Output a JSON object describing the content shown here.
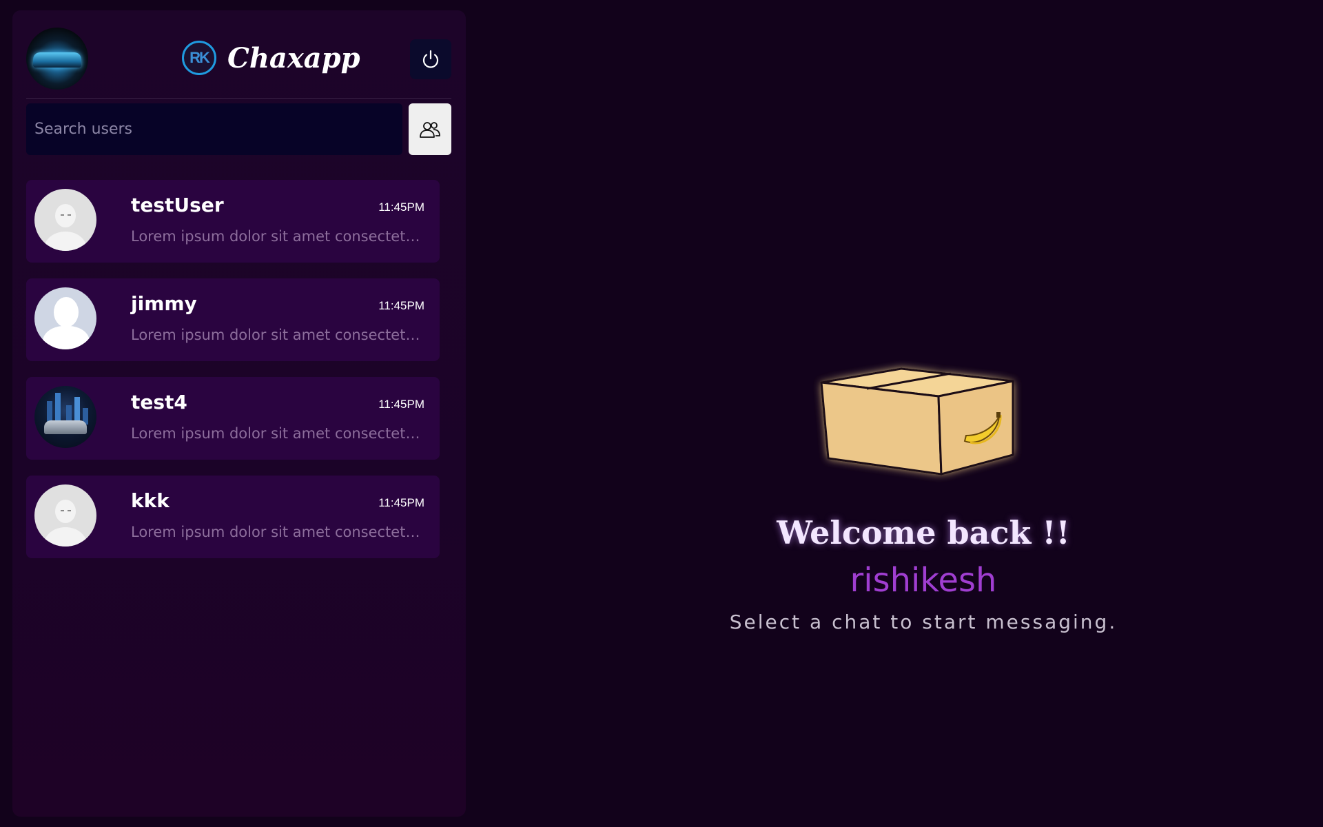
{
  "app": {
    "brand_logo_text": "RK",
    "brand_name": "Chaxapp"
  },
  "search": {
    "placeholder": "Search users",
    "value": ""
  },
  "chats": [
    {
      "name": "testUser",
      "time": "11:45PM",
      "preview": "Lorem ipsum dolor sit amet consectetur adipisicing elit.",
      "avatar": "default-avatar"
    },
    {
      "name": "jimmy",
      "time": "11:45PM",
      "preview": "Lorem ipsum dolor sit amet consectetur adipisicing elit.",
      "avatar": "silhouette-avatar"
    },
    {
      "name": "test4",
      "time": "11:45PM",
      "preview": "Lorem ipsum dolor sit amet consectetur adipisicing elit.",
      "avatar": "night-car-avatar"
    },
    {
      "name": "kkk",
      "time": "11:45PM",
      "preview": "Lorem ipsum dolor sit amet consectetur adipisicing elit.",
      "avatar": "default-avatar"
    }
  ],
  "welcome": {
    "title": "Welcome back !!",
    "username": "rishikesh",
    "subtitle": "Select a chat to start messaging."
  },
  "icons": {
    "logout": "power-icon",
    "search": "users-icon",
    "illustration": "box-with-banana-icon"
  },
  "colors": {
    "background": "#12021b",
    "sidebar": "#1d0429",
    "chat_item": "#2a0440",
    "search_input": "#070327",
    "username_accent": "#a03ed1"
  }
}
